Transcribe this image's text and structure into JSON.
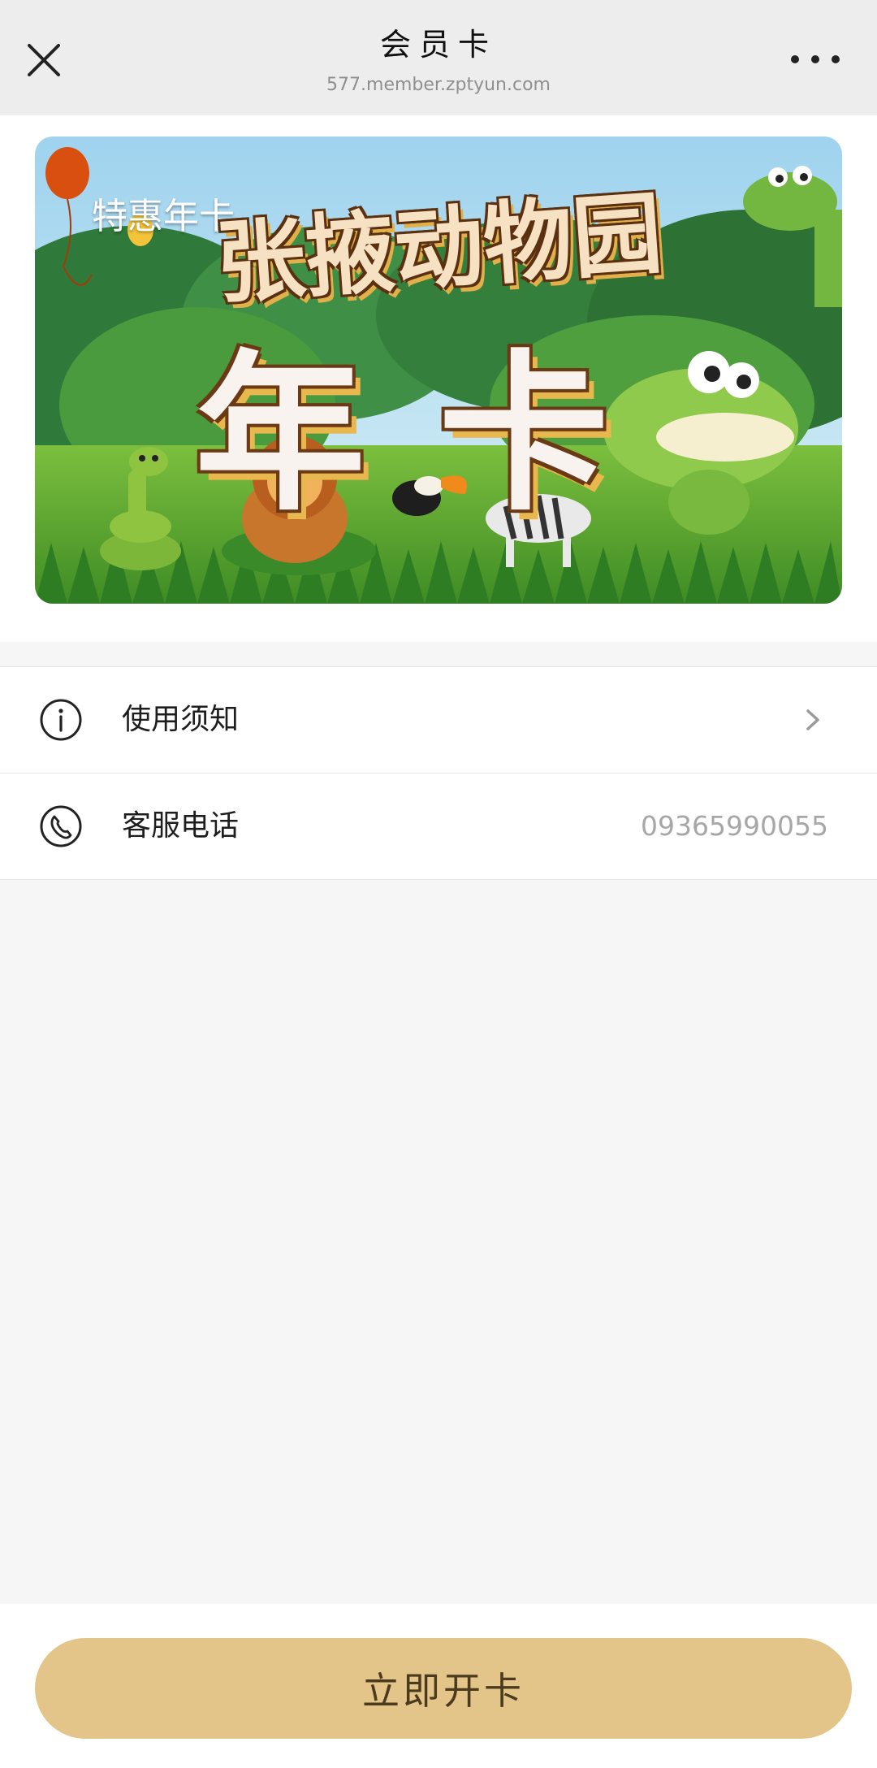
{
  "header": {
    "title": "会员卡",
    "url": "577.member.zptyun.com",
    "close_icon": "close-icon",
    "more_icon": "more-dots-icon"
  },
  "card": {
    "label": "特惠年卡",
    "title": "张掖动物园",
    "subtitle": "年卡"
  },
  "menu": {
    "notice": {
      "icon": "info-icon",
      "label": "使用须知"
    },
    "service": {
      "icon": "phone-icon",
      "label": "客服电话",
      "value": "09365990055"
    }
  },
  "footer": {
    "button_label": "立即开卡",
    "button_color": "#e4c589"
  }
}
